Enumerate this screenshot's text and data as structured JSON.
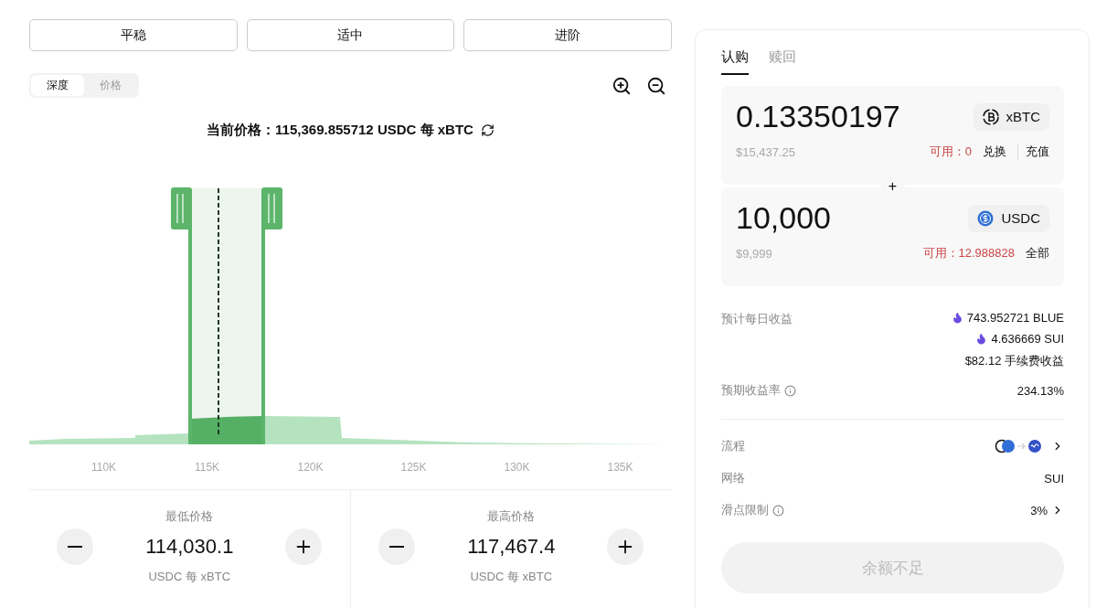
{
  "strategy_buttons": [
    {
      "label": "平稳"
    },
    {
      "label": "适中"
    },
    {
      "label": "进阶"
    }
  ],
  "view_toggle": [
    {
      "label": "深度",
      "selected": true
    },
    {
      "label": "价格",
      "selected": false
    }
  ],
  "current_price": "当前价格：115,369.855712 USDC 每 xBTC",
  "chart": {
    "axis_labels": [
      "110K",
      "115K",
      "120K",
      "125K",
      "130K",
      "135K"
    ]
  },
  "price_bounds": [
    {
      "label": "最低价格",
      "value": "114,030.1",
      "unit": "USDC 每 xBTC"
    },
    {
      "label": "最高价格",
      "value": "117,467.4",
      "unit": "USDC 每 xBTC"
    }
  ],
  "tabs": [
    {
      "label": "认购",
      "selected": true
    },
    {
      "label": "赎回",
      "selected": false
    }
  ],
  "inputs": [
    {
      "amount": "0.13350197",
      "token": "xBTC",
      "kind": "btc",
      "usd": "$15,437.25",
      "available_label": "可用：",
      "available": "0",
      "actions": [
        "兑换",
        "充值"
      ]
    },
    {
      "amount": "10,000",
      "token": "USDC",
      "kind": "usdc",
      "usd": "$9,999",
      "available_label": "可用：",
      "available": "12.988828",
      "actions": [
        "全部"
      ]
    }
  ],
  "add_sign": "+",
  "daily_rewards": {
    "label": "预计每日收益",
    "items": [
      {
        "kind": "reward",
        "text": "743.952721 BLUE"
      },
      {
        "kind": "reward",
        "text": "4.636669 SUI"
      },
      {
        "kind": "fee",
        "text": "$82.12 手续费收益"
      }
    ]
  },
  "apr": {
    "label": "预期收益率",
    "value": "234.13%"
  },
  "route": {
    "label": "流程"
  },
  "network": {
    "label": "网络",
    "value": "SUI"
  },
  "slippage": {
    "label": "滑点限制",
    "value": "3%"
  },
  "submit": {
    "label": "余额不足",
    "disabled": true
  }
}
